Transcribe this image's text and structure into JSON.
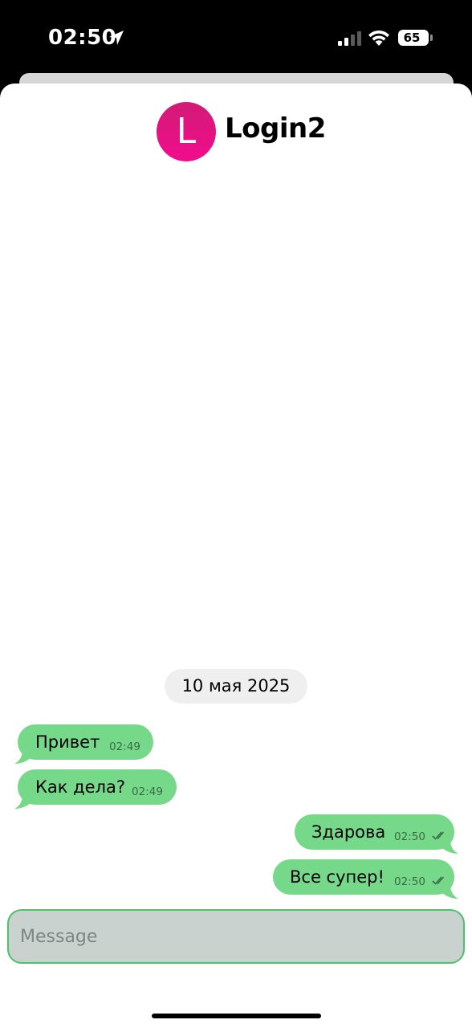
{
  "status_bar": {
    "time": "02:50",
    "battery": "65"
  },
  "chat": {
    "avatar_letter": "L",
    "title": "Login2",
    "date_separator": "10 мая 2025"
  },
  "messages": [
    {
      "text": "Привет",
      "time": "02:49",
      "direction": "incoming"
    },
    {
      "text": "Как дела?",
      "time": "02:49",
      "direction": "incoming"
    },
    {
      "text": "Здарова",
      "time": "02:50",
      "direction": "outgoing"
    },
    {
      "text": "Все супер!",
      "time": "02:50",
      "direction": "outgoing"
    }
  ],
  "composer": {
    "placeholder": "Message"
  },
  "colors": {
    "bubble": "#76d98a",
    "avatar": "#e8127f",
    "input_border": "#4ec26a"
  }
}
